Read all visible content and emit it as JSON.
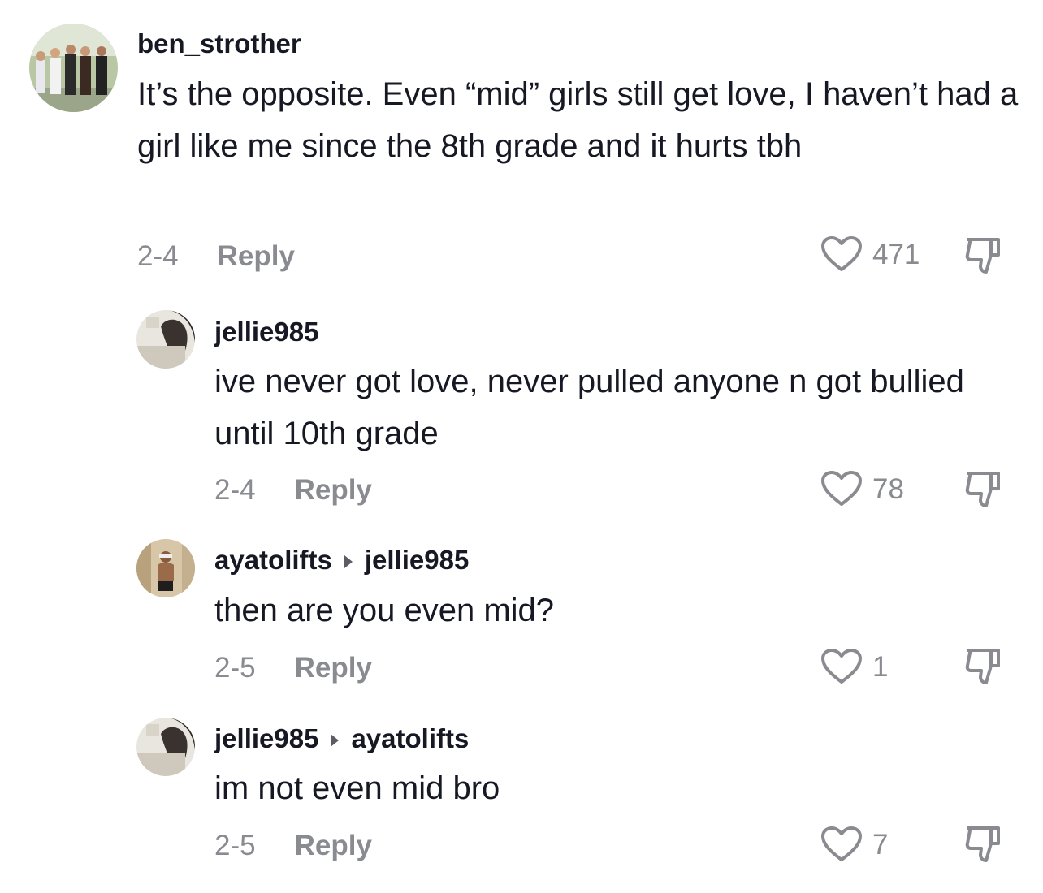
{
  "comments": [
    {
      "username": "ben_strother",
      "reply_to": "",
      "text": "It’s the opposite. Even “mid” girls still get love, I haven’t had a girl like me since the 8th grade and it hurts tbh",
      "date": "2-4",
      "reply_label": "Reply",
      "likes": "471"
    },
    {
      "username": "jellie985",
      "reply_to": "",
      "text": "ive never got love, never pulled anyone n got bullied until 10th grade",
      "date": "2-4",
      "reply_label": "Reply",
      "likes": "78"
    },
    {
      "username": "ayatolifts",
      "reply_to": "jellie985",
      "text": "then are you even mid?",
      "date": "2-5",
      "reply_label": "Reply",
      "likes": "1"
    },
    {
      "username": "jellie985",
      "reply_to": "ayatolifts",
      "text": "im not even mid bro",
      "date": "2-5",
      "reply_label": "Reply",
      "likes": "7"
    }
  ],
  "icons": {
    "like": "heart-outline-icon",
    "dislike": "thumbs-down-icon",
    "reply_arrow": "caret-right-icon"
  },
  "colors": {
    "text": "#161823",
    "meta": "#8a8b91"
  }
}
